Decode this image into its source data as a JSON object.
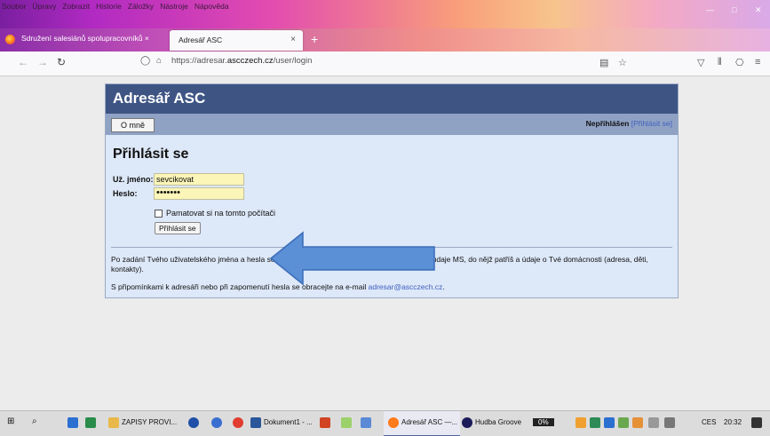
{
  "menu": [
    "Soubor",
    "Úpravy",
    "Zobrazit",
    "Historie",
    "Záložky",
    "Nástroje",
    "Nápověda"
  ],
  "tabs": [
    {
      "label": "Sdružení salesiánů spolupracovníků ×"
    },
    {
      "label": "Adresář ASC",
      "close": "×"
    }
  ],
  "new_tab": "+",
  "url": {
    "prefix": "https://adresar.",
    "domain": "ascczech.cz",
    "path": "/user/login"
  },
  "site": {
    "title": "Adresář ASC",
    "about_button": "O mně",
    "status_bold": "Nepřihlášen",
    "status_link": "[Přihlásit se]",
    "login_heading": "Přihlásit se",
    "username_label": "Už. jméno:",
    "username_value": "sevcikovat",
    "password_label": "Heslo:",
    "password_value": "•••••••",
    "remember_label": "Pamatovat si na tomto počítači",
    "submit_label": "Přihlásit se",
    "info_text": "Po zadání Tvého uživatelského jména a hesla se Ti zobrazí Hlavní strana obsahující Tvé údaje, údaje MS, do nějž patříš a údaje o Tvé domácnosti (adresa, děti, kontakty).",
    "contact_prefix": "S připomínkami k adresáři nebo při zapomenutí hesla se obracejte na e-mail ",
    "contact_email": "adresar@ascczech.cz",
    "contact_suffix": "."
  },
  "taskbar": {
    "items": [
      "ZAPISY PROVI...",
      "Dokument1 - ...",
      "Adresář ASC —...",
      "Hudba Groove"
    ],
    "battery": "0%",
    "lang": "CES",
    "time": "20:32"
  },
  "colors": {
    "header": "#3e5584",
    "subbar": "#8fa2c4",
    "panel": "#dde8f8",
    "arrow": "#5b8fd6"
  }
}
